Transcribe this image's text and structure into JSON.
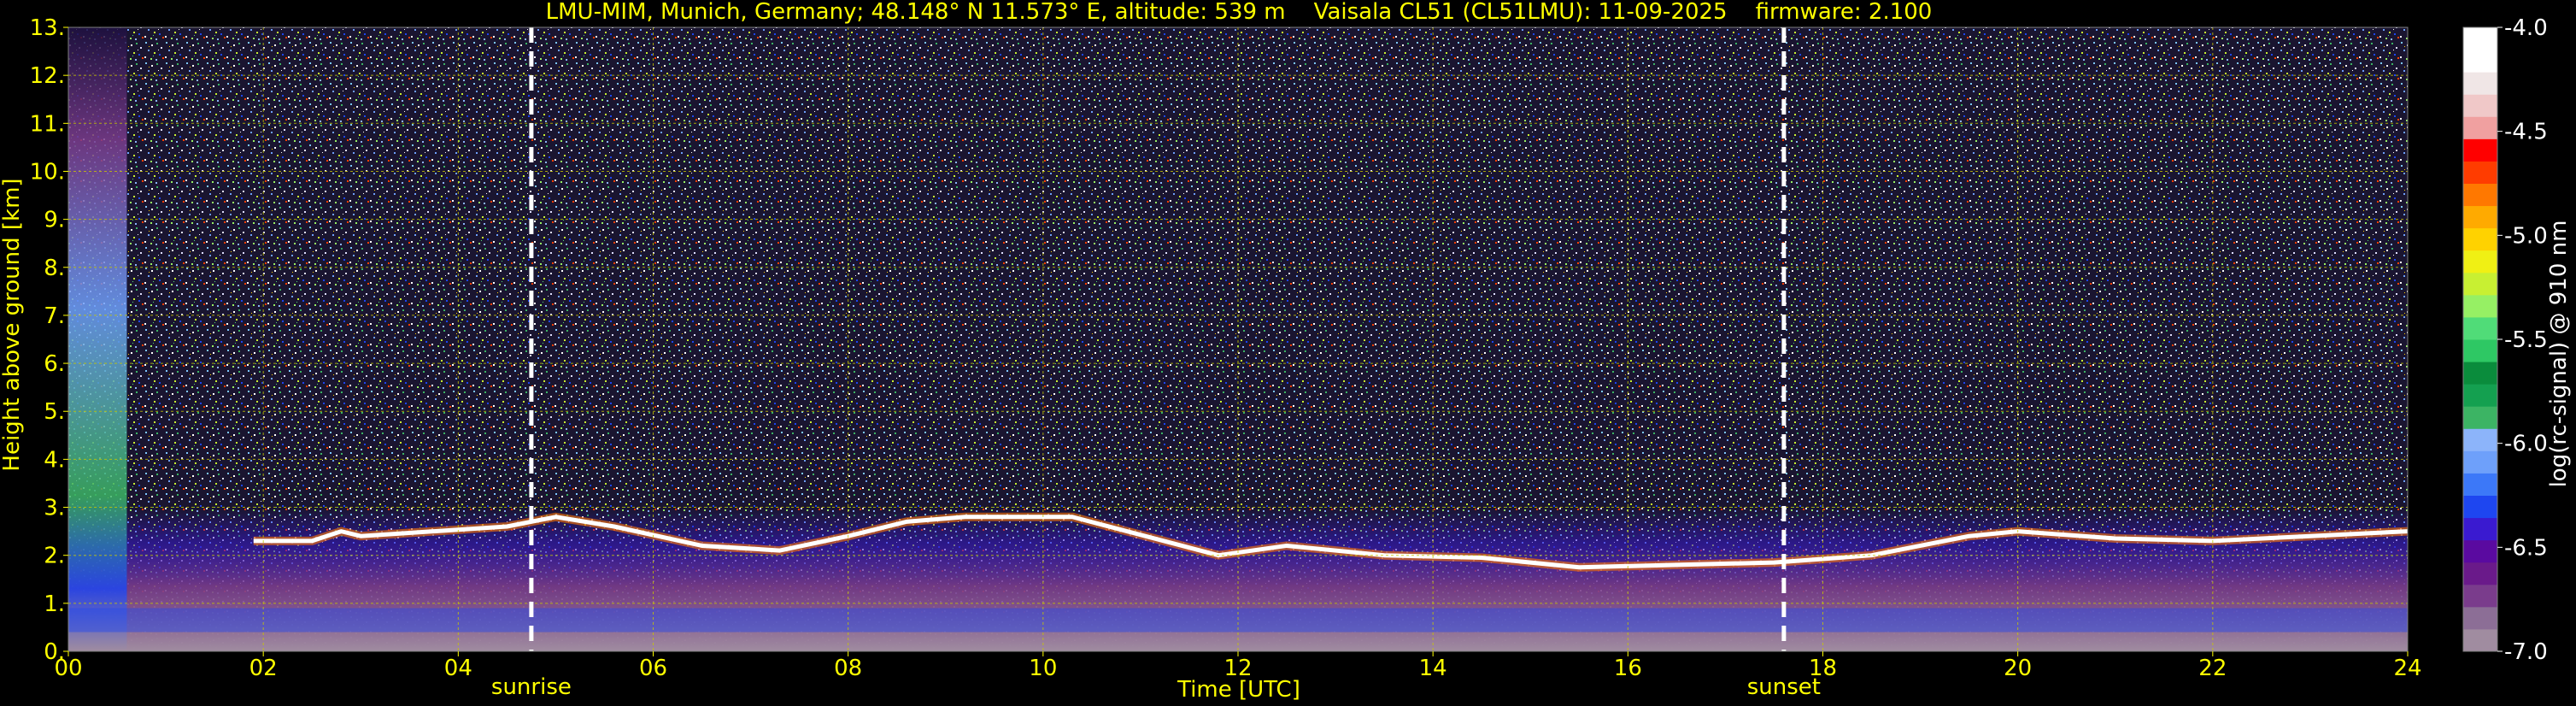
{
  "chart_data": {
    "type": "heatmap",
    "title": "LMU-MIM, Munich, Germany; 48.148° N 11.573° E, altitude: 539 m    Vaisala CL51 (CL51LMU): 11-09-2025    firmware: 2.100",
    "xlabel": "Time [UTC]",
    "ylabel": "Height above ground [km]",
    "xlim": [
      0,
      24
    ],
    "ylim": [
      0,
      13
    ],
    "x_ticks": [
      "00",
      "02",
      "04",
      "06",
      "08",
      "10",
      "12",
      "14",
      "16",
      "18",
      "20",
      "22",
      "24"
    ],
    "y_ticks": [
      "0.",
      "1.",
      "2.",
      "3.",
      "4.",
      "5.",
      "6.",
      "7.",
      "8.",
      "9.",
      "10.",
      "11.",
      "12.",
      "13."
    ],
    "grid": true,
    "colorbar": {
      "label": "log(rc-signal) @ 910 nm",
      "range": [
        -7.0,
        -4.0
      ],
      "ticks": [
        "-7.0",
        "-6.5",
        "-6.0",
        "-5.5",
        "-5.0",
        "-4.5",
        "-4.0"
      ],
      "colors": [
        "#a08ca0",
        "#8c6e96",
        "#7a3c8c",
        "#6a1a8a",
        "#5a0aa0",
        "#3a1ad0",
        "#1e46f0",
        "#3c78f8",
        "#6ea0fa",
        "#8cb4fa",
        "#3cb464",
        "#14a050",
        "#0a8c3c",
        "#2ec864",
        "#50dc78",
        "#96f064",
        "#c8f032",
        "#f0f014",
        "#ffd200",
        "#ffaa00",
        "#ff7800",
        "#ff3c00",
        "#ff0000",
        "#f0a0a0",
        "#f0c8c8",
        "#f0e6e6",
        "#ffffff",
        "#ffffff"
      ]
    },
    "annotations": [
      {
        "label": "sunrise",
        "x": 4.75
      },
      {
        "label": "sunset",
        "x": 17.6
      }
    ],
    "cloud_base_height_km": [
      {
        "x": 1.9,
        "y": 2.3
      },
      {
        "x": 2.5,
        "y": 2.3
      },
      {
        "x": 2.8,
        "y": 2.5
      },
      {
        "x": 3.0,
        "y": 2.4
      },
      {
        "x": 4.5,
        "y": 2.6
      },
      {
        "x": 5.0,
        "y": 2.8
      },
      {
        "x": 5.6,
        "y": 2.6
      },
      {
        "x": 6.5,
        "y": 2.2
      },
      {
        "x": 7.3,
        "y": 2.1
      },
      {
        "x": 8.0,
        "y": 2.4
      },
      {
        "x": 8.6,
        "y": 2.7
      },
      {
        "x": 9.2,
        "y": 2.8
      },
      {
        "x": 10.3,
        "y": 2.8
      },
      {
        "x": 11.8,
        "y": 2.0
      },
      {
        "x": 12.5,
        "y": 2.2
      },
      {
        "x": 13.5,
        "y": 2.0
      },
      {
        "x": 14.5,
        "y": 1.95
      },
      {
        "x": 15.5,
        "y": 1.75
      },
      {
        "x": 16.5,
        "y": 1.8
      },
      {
        "x": 17.5,
        "y": 1.85
      },
      {
        "x": 18.5,
        "y": 2.0
      },
      {
        "x": 19.5,
        "y": 2.4
      },
      {
        "x": 20.0,
        "y": 2.5
      },
      {
        "x": 21.0,
        "y": 2.35
      },
      {
        "x": 22.0,
        "y": 2.3
      },
      {
        "x": 23.0,
        "y": 2.4
      },
      {
        "x": 24.0,
        "y": 2.5
      }
    ]
  }
}
